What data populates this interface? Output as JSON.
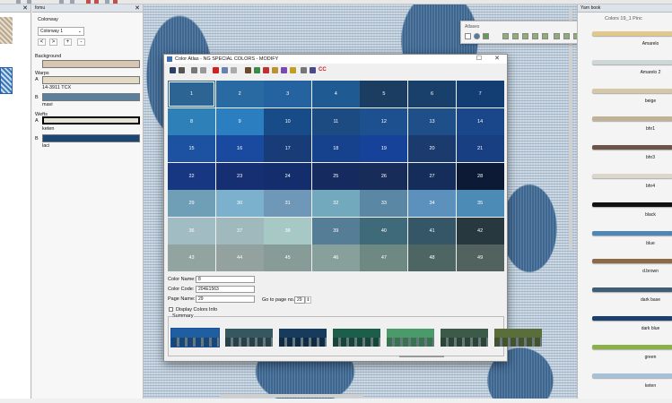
{
  "left_panel_1": {
    "icons": [
      "close-icon"
    ]
  },
  "left_panel_2": {
    "title": "fomu",
    "colorway_label": "Colorway",
    "colorway_value": "Colorway 1",
    "nav_buttons": [
      "<",
      ">",
      "+",
      "-"
    ],
    "background_label": "Background",
    "warps_label": "Warps",
    "weft_label": "Wefts",
    "warps": [
      {
        "letter": "A",
        "name": "14-3911 TCX",
        "color": "#e2dac4"
      },
      {
        "letter": "B",
        "name": "mavi",
        "color": "#5c7f9b"
      }
    ],
    "wefts": [
      {
        "letter": "A",
        "name": "keten",
        "color": "#e6e2d8"
      },
      {
        "letter": "B",
        "name": "laci",
        "color": "#1c4674"
      }
    ],
    "background_color": "#d7c7b2"
  },
  "atlases": {
    "title": "Atlases"
  },
  "right_panel": {
    "title": "Yarn book",
    "colors_title": "Colors 19_1 Pinc",
    "yarns": [
      {
        "name": "Amarelo",
        "color": "#e2c98b"
      },
      {
        "name": "Amarelo 2",
        "color": "#cfd6d8"
      },
      {
        "name": "beige",
        "color": "#d4c8a6"
      },
      {
        "name": "bhr1",
        "color": "#c0b296"
      },
      {
        "name": "bhr3",
        "color": "#6c5548"
      },
      {
        "name": "bhr4",
        "color": "#dcd6cc"
      },
      {
        "name": "black",
        "color": "#111111"
      },
      {
        "name": "blue",
        "color": "#4f86b8"
      },
      {
        "name": "d.brown",
        "color": "#8c6a48"
      },
      {
        "name": "dark base",
        "color": "#3f5e76"
      },
      {
        "name": "dark blue",
        "color": "#1b3f6e"
      },
      {
        "name": "green",
        "color": "#8ab04a"
      },
      {
        "name": "keten",
        "color": "#a6c0d8"
      }
    ]
  },
  "dialog": {
    "title": "Color Atlas - NG SPECIAL COLORS - MODIFY",
    "minimize": "☐",
    "close": "✕",
    "color_name_label": "Color Name:",
    "color_name_value": "8",
    "color_code_label": "Color Code:",
    "color_code_value": "204E1563",
    "page_name_label": "Page Name:",
    "page_name_value": "29",
    "goto_label": "Go to page no.",
    "goto_value": "29",
    "display_label": "Display Colors Info",
    "summary_label": "Summary",
    "cells": [
      {
        "n": "1",
        "c": "#2c6593"
      },
      {
        "n": "2",
        "c": "#2a6aa3"
      },
      {
        "n": "3",
        "c": "#2462a0"
      },
      {
        "n": "4",
        "c": "#1f5a93"
      },
      {
        "n": "5",
        "c": "#1b3d62"
      },
      {
        "n": "6",
        "c": "#19406b"
      },
      {
        "n": "7",
        "c": "#133e73"
      },
      {
        "n": "8",
        "c": "#2e80b9"
      },
      {
        "n": "9",
        "c": "#2b7fc0"
      },
      {
        "n": "10",
        "c": "#184c89"
      },
      {
        "n": "11",
        "c": "#1c4b82"
      },
      {
        "n": "12",
        "c": "#1d508f"
      },
      {
        "n": "13",
        "c": "#1f4f88"
      },
      {
        "n": "14",
        "c": "#1a468a"
      },
      {
        "n": "15",
        "c": "#1c52a1"
      },
      {
        "n": "16",
        "c": "#1a4aa0"
      },
      {
        "n": "17",
        "c": "#173c78"
      },
      {
        "n": "18",
        "c": "#16418c"
      },
      {
        "n": "19",
        "c": "#164399"
      },
      {
        "n": "20",
        "c": "#1b3a6e"
      },
      {
        "n": "21",
        "c": "#193f83"
      },
      {
        "n": "22",
        "c": "#173783"
      },
      {
        "n": "23",
        "c": "#162f72"
      },
      {
        "n": "24",
        "c": "#142d6c"
      },
      {
        "n": "25",
        "c": "#152b5f"
      },
      {
        "n": "26",
        "c": "#182c5a"
      },
      {
        "n": "27",
        "c": "#142d5b"
      },
      {
        "n": "28",
        "c": "#0d1a36"
      },
      {
        "n": "29",
        "c": "#6f9fb7"
      },
      {
        "n": "30",
        "c": "#7cb1cd"
      },
      {
        "n": "31",
        "c": "#6f97b8"
      },
      {
        "n": "32",
        "c": "#73a9bd"
      },
      {
        "n": "33",
        "c": "#5a87a3"
      },
      {
        "n": "34",
        "c": "#5c91be"
      },
      {
        "n": "35",
        "c": "#4d8bb7"
      },
      {
        "n": "36",
        "c": "#a2bcc4"
      },
      {
        "n": "37",
        "c": "#9fb9bd"
      },
      {
        "n": "38",
        "c": "#a6c9c6"
      },
      {
        "n": "39",
        "c": "#557d95"
      },
      {
        "n": "40",
        "c": "#3f6a79"
      },
      {
        "n": "41",
        "c": "#345666"
      },
      {
        "n": "42",
        "c": "#27383f"
      },
      {
        "n": "43",
        "c": "#91a4a0"
      },
      {
        "n": "44",
        "c": "#93a29f"
      },
      {
        "n": "45",
        "c": "#889c97"
      },
      {
        "n": "46",
        "c": "#88a09c"
      },
      {
        "n": "47",
        "c": "#6e8882"
      },
      {
        "n": "48",
        "c": "#4e6663"
      },
      {
        "n": "49",
        "c": "#52625f"
      }
    ],
    "summary": [
      "#1f5ea0",
      "#355760",
      "#163b5c",
      "#1d5e4a",
      "#4a9a6a",
      "#3b5a48",
      "#5a6e3c"
    ]
  }
}
